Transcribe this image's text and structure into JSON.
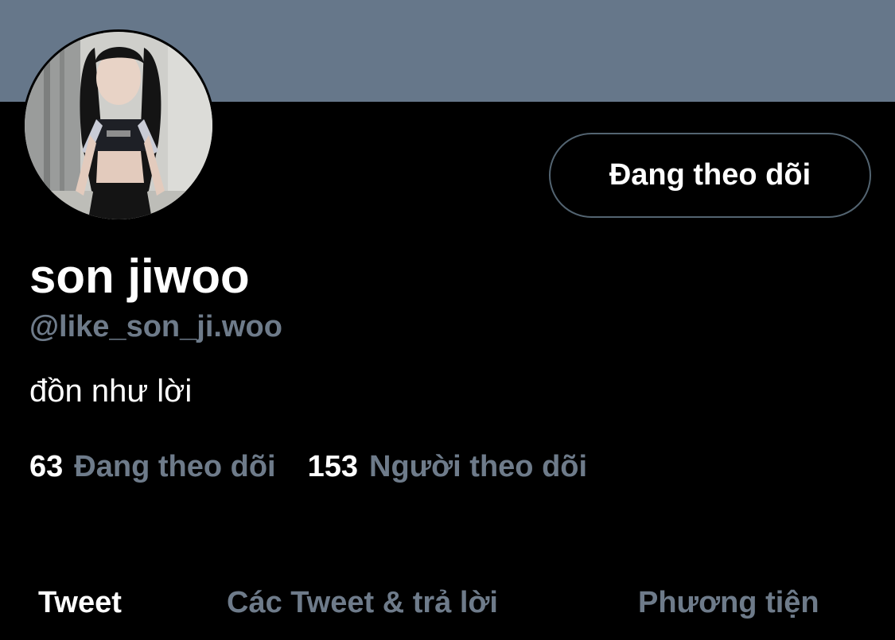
{
  "profile": {
    "display_name": "son jiwoo",
    "handle": "@like_son_ji.woo",
    "bio": "đồn như lời",
    "follow_button_label": "Đang theo dõi"
  },
  "stats": {
    "following_count": "63",
    "following_label": "Đang theo dõi",
    "followers_count": "153",
    "followers_label": "Người theo dõi"
  },
  "tabs": [
    {
      "label": "Tweet",
      "active": true
    },
    {
      "label": "Các Tweet & trả lời",
      "active": false
    },
    {
      "label": "Phương tiện",
      "active": false
    }
  ],
  "colors": {
    "banner": "#66778a",
    "background": "#000000",
    "primary_text": "#ffffff",
    "secondary_text": "#6e7b8a",
    "button_border": "#536471"
  }
}
